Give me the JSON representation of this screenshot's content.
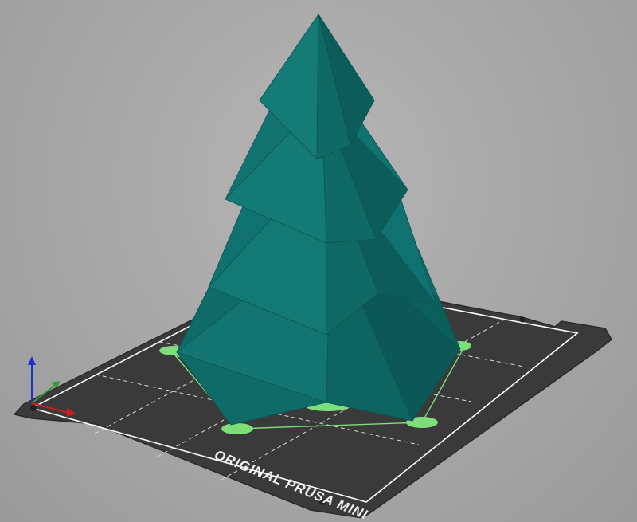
{
  "viewport": {
    "background": "#a8a8a8"
  },
  "bed": {
    "label": "ORIGINAL PRUSA MINI",
    "surface_color": "#3b3b3b",
    "border_color": "#ffffff"
  },
  "model": {
    "color": "#0f6b68",
    "brim_color": "#7edf7a"
  },
  "axes": {
    "x_color": "#d01b1b",
    "y_color": "#2f9d2f",
    "z_color": "#1f2fd0"
  }
}
